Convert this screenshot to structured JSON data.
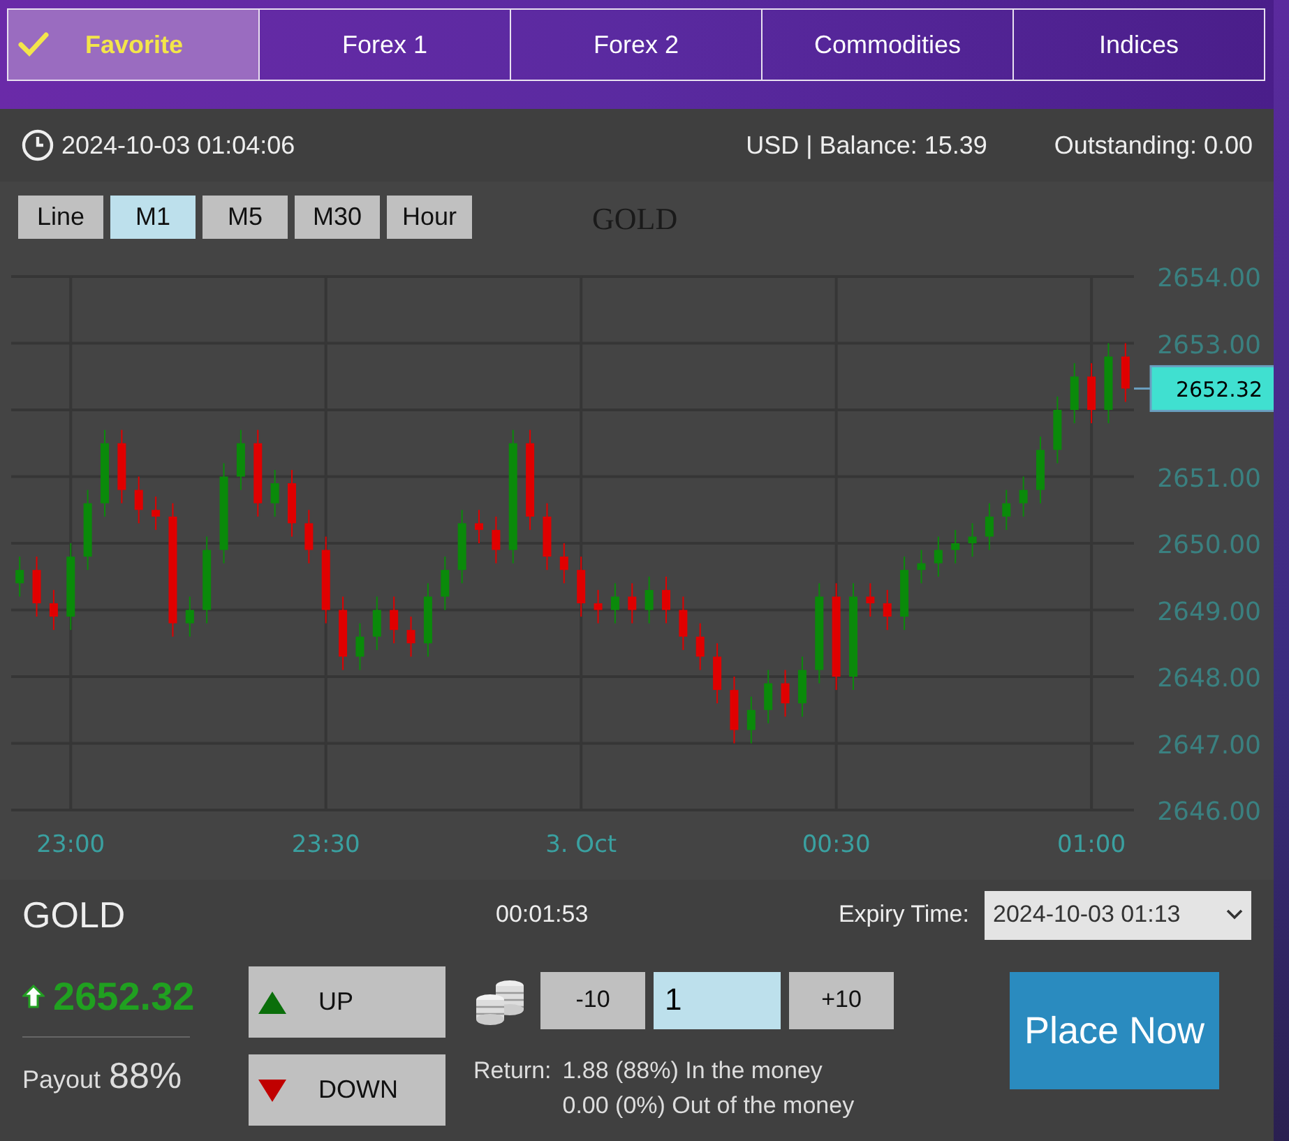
{
  "tabs": [
    {
      "label": "Favorite",
      "selected": true
    },
    {
      "label": "Forex 1",
      "selected": false
    },
    {
      "label": "Forex 2",
      "selected": false
    },
    {
      "label": "Commodities",
      "selected": false
    },
    {
      "label": "Indices",
      "selected": false
    }
  ],
  "info_bar": {
    "datetime": "2024-10-03 01:04:06",
    "balance": "USD | Balance: 15.39",
    "outstanding": "Outstanding: 0.00"
  },
  "chart": {
    "periods": [
      {
        "label": "Line",
        "selected": false
      },
      {
        "label": "M1",
        "selected": true
      },
      {
        "label": "M5",
        "selected": false
      },
      {
        "label": "M30",
        "selected": false
      },
      {
        "label": "Hour",
        "selected": false
      }
    ],
    "last_price_tag": "2652.32",
    "chart_data": {
      "type": "candlestick",
      "title": "GOLD",
      "grid": true,
      "ylim": [
        2646,
        2654
      ],
      "yticks": [
        {
          "value": 2654,
          "label": "2654.00"
        },
        {
          "value": 2653,
          "label": "2653.00"
        },
        {
          "value": 2651,
          "label": "2651.00"
        },
        {
          "value": 2650,
          "label": "2650.00"
        },
        {
          "value": 2649,
          "label": "2649.00"
        },
        {
          "value": 2648,
          "label": "2648.00"
        },
        {
          "value": 2647,
          "label": "2647.00"
        },
        {
          "value": 2646,
          "label": "2646.00"
        }
      ],
      "categories": [
        null,
        null,
        null,
        "23:00",
        null,
        null,
        null,
        null,
        null,
        null,
        null,
        null,
        null,
        null,
        null,
        null,
        null,
        null,
        "23:30",
        null,
        null,
        null,
        null,
        null,
        null,
        null,
        null,
        null,
        null,
        null,
        null,
        null,
        null,
        "3. Oct",
        null,
        null,
        null,
        null,
        null,
        null,
        null,
        null,
        null,
        null,
        null,
        null,
        null,
        null,
        "00:30",
        null,
        null,
        null,
        null,
        null,
        null,
        null,
        null,
        null,
        null,
        null,
        null,
        null,
        null,
        "01:00",
        null,
        null
      ],
      "ohlc": [
        [
          2649.4,
          2649.8,
          2649.2,
          2649.6
        ],
        [
          2649.6,
          2649.8,
          2648.9,
          2649.1
        ],
        [
          2649.1,
          2649.3,
          2648.7,
          2648.9
        ],
        [
          2648.9,
          2650.0,
          2648.7,
          2649.8
        ],
        [
          2649.8,
          2650.8,
          2649.6,
          2650.6
        ],
        [
          2650.6,
          2651.7,
          2650.4,
          2651.5
        ],
        [
          2651.5,
          2651.7,
          2650.6,
          2650.8
        ],
        [
          2650.8,
          2651.0,
          2650.3,
          2650.5
        ],
        [
          2650.5,
          2650.7,
          2650.2,
          2650.4
        ],
        [
          2650.4,
          2650.6,
          2648.6,
          2648.8
        ],
        [
          2648.8,
          2649.2,
          2648.6,
          2649.0
        ],
        [
          2649.0,
          2650.1,
          2648.8,
          2649.9
        ],
        [
          2649.9,
          2651.2,
          2649.7,
          2651.0
        ],
        [
          2651.0,
          2651.7,
          2650.8,
          2651.5
        ],
        [
          2651.5,
          2651.7,
          2650.4,
          2650.6
        ],
        [
          2650.6,
          2651.1,
          2650.4,
          2650.9
        ],
        [
          2650.9,
          2651.1,
          2650.1,
          2650.3
        ],
        [
          2650.3,
          2650.5,
          2649.7,
          2649.9
        ],
        [
          2649.9,
          2650.1,
          2648.8,
          2649.0
        ],
        [
          2649.0,
          2649.2,
          2648.1,
          2648.3
        ],
        [
          2648.3,
          2648.8,
          2648.1,
          2648.6
        ],
        [
          2648.6,
          2649.2,
          2648.4,
          2649.0
        ],
        [
          2649.0,
          2649.2,
          2648.5,
          2648.7
        ],
        [
          2648.7,
          2648.9,
          2648.3,
          2648.5
        ],
        [
          2648.5,
          2649.4,
          2648.3,
          2649.2
        ],
        [
          2649.2,
          2649.8,
          2649.0,
          2649.6
        ],
        [
          2649.6,
          2650.5,
          2649.4,
          2650.3
        ],
        [
          2650.3,
          2650.5,
          2650.0,
          2650.2
        ],
        [
          2650.2,
          2650.4,
          2649.7,
          2649.9
        ],
        [
          2649.9,
          2651.7,
          2649.7,
          2651.5
        ],
        [
          2651.5,
          2651.7,
          2650.2,
          2650.4
        ],
        [
          2650.4,
          2650.6,
          2649.6,
          2649.8
        ],
        [
          2649.8,
          2650.0,
          2649.4,
          2649.6
        ],
        [
          2649.6,
          2649.8,
          2648.9,
          2649.1
        ],
        [
          2649.1,
          2649.3,
          2648.8,
          2649.0
        ],
        [
          2649.0,
          2649.4,
          2648.8,
          2649.2
        ],
        [
          2649.2,
          2649.4,
          2648.8,
          2649.0
        ],
        [
          2649.0,
          2649.5,
          2648.8,
          2649.3
        ],
        [
          2649.3,
          2649.5,
          2648.8,
          2649.0
        ],
        [
          2649.0,
          2649.2,
          2648.4,
          2648.6
        ],
        [
          2648.6,
          2648.8,
          2648.1,
          2648.3
        ],
        [
          2648.3,
          2648.5,
          2647.6,
          2647.8
        ],
        [
          2647.8,
          2648.0,
          2647.0,
          2647.2
        ],
        [
          2647.2,
          2647.7,
          2647.0,
          2647.5
        ],
        [
          2647.5,
          2648.1,
          2647.3,
          2647.9
        ],
        [
          2647.9,
          2648.1,
          2647.4,
          2647.6
        ],
        [
          2647.6,
          2648.3,
          2647.4,
          2648.1
        ],
        [
          2648.1,
          2649.4,
          2647.9,
          2649.2
        ],
        [
          2649.2,
          2649.4,
          2647.8,
          2648.0
        ],
        [
          2648.0,
          2649.4,
          2647.8,
          2649.2
        ],
        [
          2649.2,
          2649.4,
          2648.9,
          2649.1
        ],
        [
          2649.1,
          2649.3,
          2648.7,
          2648.9
        ],
        [
          2648.9,
          2649.8,
          2648.7,
          2649.6
        ],
        [
          2649.6,
          2649.9,
          2649.4,
          2649.7
        ],
        [
          2649.7,
          2650.1,
          2649.5,
          2649.9
        ],
        [
          2649.9,
          2650.2,
          2649.7,
          2650.0
        ],
        [
          2650.0,
          2650.3,
          2649.8,
          2650.1
        ],
        [
          2650.1,
          2650.6,
          2649.9,
          2650.4
        ],
        [
          2650.4,
          2650.8,
          2650.2,
          2650.6
        ],
        [
          2650.6,
          2651.0,
          2650.4,
          2650.8
        ],
        [
          2650.8,
          2651.6,
          2650.6,
          2651.4
        ],
        [
          2651.4,
          2652.2,
          2651.2,
          2652.0
        ],
        [
          2652.0,
          2652.7,
          2651.8,
          2652.5
        ],
        [
          2652.5,
          2652.7,
          2651.8,
          2652.0
        ],
        [
          2652.0,
          2653.0,
          2651.8,
          2652.8
        ],
        [
          2652.8,
          2653.0,
          2652.12,
          2652.32
        ]
      ]
    }
  },
  "trade": {
    "symbol": "GOLD",
    "countdown": "00:01:53",
    "expiry_label": "Expiry Time:",
    "expiry_value": "2024-10-03 01:13",
    "price": "2652.32",
    "payout_label": "Payout",
    "payout_value": "88%",
    "up_label": "UP",
    "down_label": "DOWN",
    "minus_label": "-10",
    "amount": "1",
    "plus_label": "+10",
    "return_label": "Return:",
    "return_in": "1.88 (88%) In the money",
    "return_out": "0.00 (0%) Out of the money",
    "place_label": "Place Now"
  }
}
